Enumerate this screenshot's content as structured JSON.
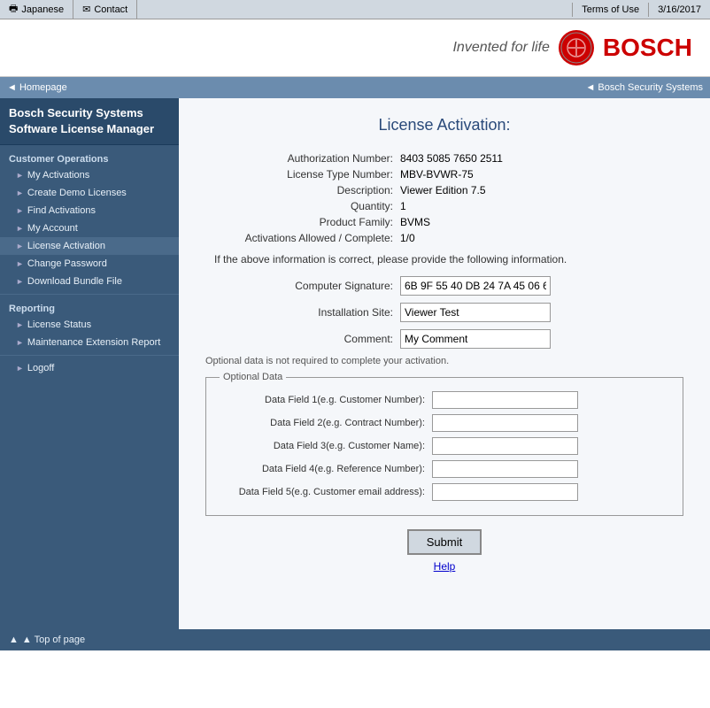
{
  "topbar": {
    "left": [
      {
        "label": "Japanese",
        "icon": "🖶"
      },
      {
        "label": "Contact",
        "icon": "✉"
      }
    ],
    "right": [
      {
        "label": "Terms of Use"
      },
      {
        "label": "3/16/2017"
      }
    ]
  },
  "header": {
    "tagline": "Invented for life",
    "brand": "BOSCH"
  },
  "breadcrumbs": {
    "left": "◄ Homepage",
    "right": "◄ Bosch Security Systems"
  },
  "sidebar": {
    "title_line1": "Bosch Security Systems",
    "title_line2": "Software License Manager",
    "customer_ops_label": "Customer Operations",
    "items": [
      {
        "label": "My Activations",
        "id": "my-activations"
      },
      {
        "label": "Create Demo Licenses",
        "id": "create-demo"
      },
      {
        "label": "Find Activations",
        "id": "find-activations"
      },
      {
        "label": "My Account",
        "id": "my-account"
      },
      {
        "label": "License Activation",
        "id": "license-activation"
      },
      {
        "label": "Change Password",
        "id": "change-password"
      },
      {
        "label": "Download Bundle File",
        "id": "download-bundle"
      }
    ],
    "reporting_label": "Reporting",
    "reporting_items": [
      {
        "label": "License Status",
        "id": "license-status"
      },
      {
        "label": "Maintenance Extension Report",
        "id": "maintenance-report"
      }
    ],
    "logoff_label": "Logoff",
    "top_of_page": "▲ Top of page"
  },
  "main": {
    "page_title": "License Activation:",
    "info_fields": [
      {
        "label": "Authorization Number:",
        "value": "8403 5085 7650 2511"
      },
      {
        "label": "License Type Number:",
        "value": "MBV-BVWR-75"
      },
      {
        "label": "Description:",
        "value": "Viewer Edition 7.5"
      },
      {
        "label": "Quantity:",
        "value": "1"
      },
      {
        "label": "Product Family:",
        "value": "BVMS"
      },
      {
        "label": "Activations Allowed / Complete:",
        "value": "1/0"
      }
    ],
    "instruction_text": "If the above information is correct, please provide the following information.",
    "form_fields": [
      {
        "label": "Computer Signature:",
        "value": "6B 9F 55 40 DB 24 7A 45 06 6",
        "id": "computer-signature"
      },
      {
        "label": "Installation Site:",
        "value": "Viewer Test",
        "id": "installation-site"
      },
      {
        "label": "Comment:",
        "value": "My Comment",
        "id": "comment"
      }
    ],
    "optional_text": "Optional data is not required to complete your activation.",
    "optional_legend": "Optional Data",
    "optional_fields": [
      {
        "label": "Data Field 1(e.g. Customer Number):",
        "id": "data-field-1",
        "value": ""
      },
      {
        "label": "Data Field 2(e.g. Contract Number):",
        "id": "data-field-2",
        "value": ""
      },
      {
        "label": "Data Field 3(e.g. Customer Name):",
        "id": "data-field-3",
        "value": ""
      },
      {
        "label": "Data Field 4(e.g. Reference Number):",
        "id": "data-field-4",
        "value": ""
      },
      {
        "label": "Data Field 5(e.g. Customer email address):",
        "id": "data-field-5",
        "value": ""
      }
    ],
    "submit_label": "Submit",
    "help_label": "Help"
  }
}
